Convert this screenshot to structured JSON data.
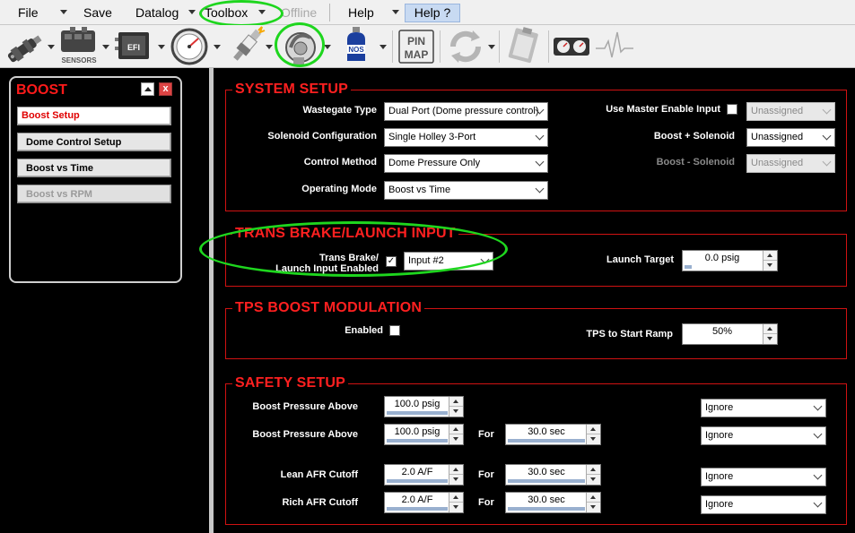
{
  "menu": {
    "file": "File",
    "save": "Save",
    "datalog": "Datalog",
    "toolbox": "Toolbox",
    "offline": "Offline",
    "help": "Help",
    "help_q": "Help ?"
  },
  "toolbar": {
    "sensors_label": "SENSORS",
    "efi_label": "EFI",
    "nos_label": "NOS",
    "pin_label": "PIN",
    "map_label": "MAP",
    "icons": [
      "injector-icon",
      "sensors-icon",
      "efi-icon",
      "gauge-icon",
      "spark-plug-icon",
      "turbo-icon",
      "nos-bottle-icon",
      "pin-map-icon",
      "refresh-icon",
      "clipboard-icon",
      "dual-gauge-icon",
      "ecg-icon"
    ]
  },
  "sidebar": {
    "title": "BOOST",
    "items": [
      {
        "label": "Boost Setup"
      },
      {
        "label": "Dome Control Setup"
      },
      {
        "label": "Boost vs Time"
      },
      {
        "label": "Boost vs RPM"
      }
    ]
  },
  "system_setup": {
    "title": "SYSTEM SETUP",
    "wastegate_label": "Wastegate Type",
    "wastegate_value": "Dual Port (Dome pressure control)",
    "solenoid_label": "Solenoid Configuration",
    "solenoid_value": "Single Holley 3-Port",
    "control_label": "Control Method",
    "control_value": "Dome Pressure Only",
    "operating_label": "Operating Mode",
    "operating_value": "Boost vs Time",
    "master_label": "Use Master Enable Input",
    "master_value": "Unassigned",
    "boost_plus_label": "Boost + Solenoid",
    "boost_plus_value": "Unassigned",
    "boost_minus_label": "Boost - Solenoid",
    "boost_minus_value": "Unassigned"
  },
  "trans_brake": {
    "title": "TRANS BRAKE/LAUNCH INPUT",
    "input_label_1": "Trans Brake/",
    "input_label_2": "Launch Input Enabled",
    "input_value": "Input #2",
    "launch_label": "Launch Target",
    "launch_value": "0.0 psig",
    "launch_fill": 0.0
  },
  "tps": {
    "title": "TPS BOOST MODULATION",
    "enabled_label": "Enabled",
    "ramp_label": "TPS to Start Ramp",
    "ramp_value": "50%",
    "ramp_fill": 0.0
  },
  "safety": {
    "title": "SAFETY SETUP",
    "for_label": "For",
    "rows": [
      {
        "label": "Boost Pressure Above",
        "value": "100.0 psig",
        "for_value": "",
        "action": "Ignore"
      },
      {
        "label": "Boost Pressure Above",
        "value": "100.0 psig",
        "for_value": "30.0 sec",
        "action": "Ignore"
      },
      {
        "label": "Lean AFR Cutoff",
        "value": "2.0 A/F",
        "for_value": "30.0 sec",
        "action": "Ignore"
      },
      {
        "label": "Rich AFR Cutoff",
        "value": "2.0 A/F",
        "for_value": "30.0 sec",
        "action": "Ignore"
      }
    ]
  },
  "colors": {
    "accent_red": "#ff2020",
    "highlight_green": "#1ed61e"
  }
}
